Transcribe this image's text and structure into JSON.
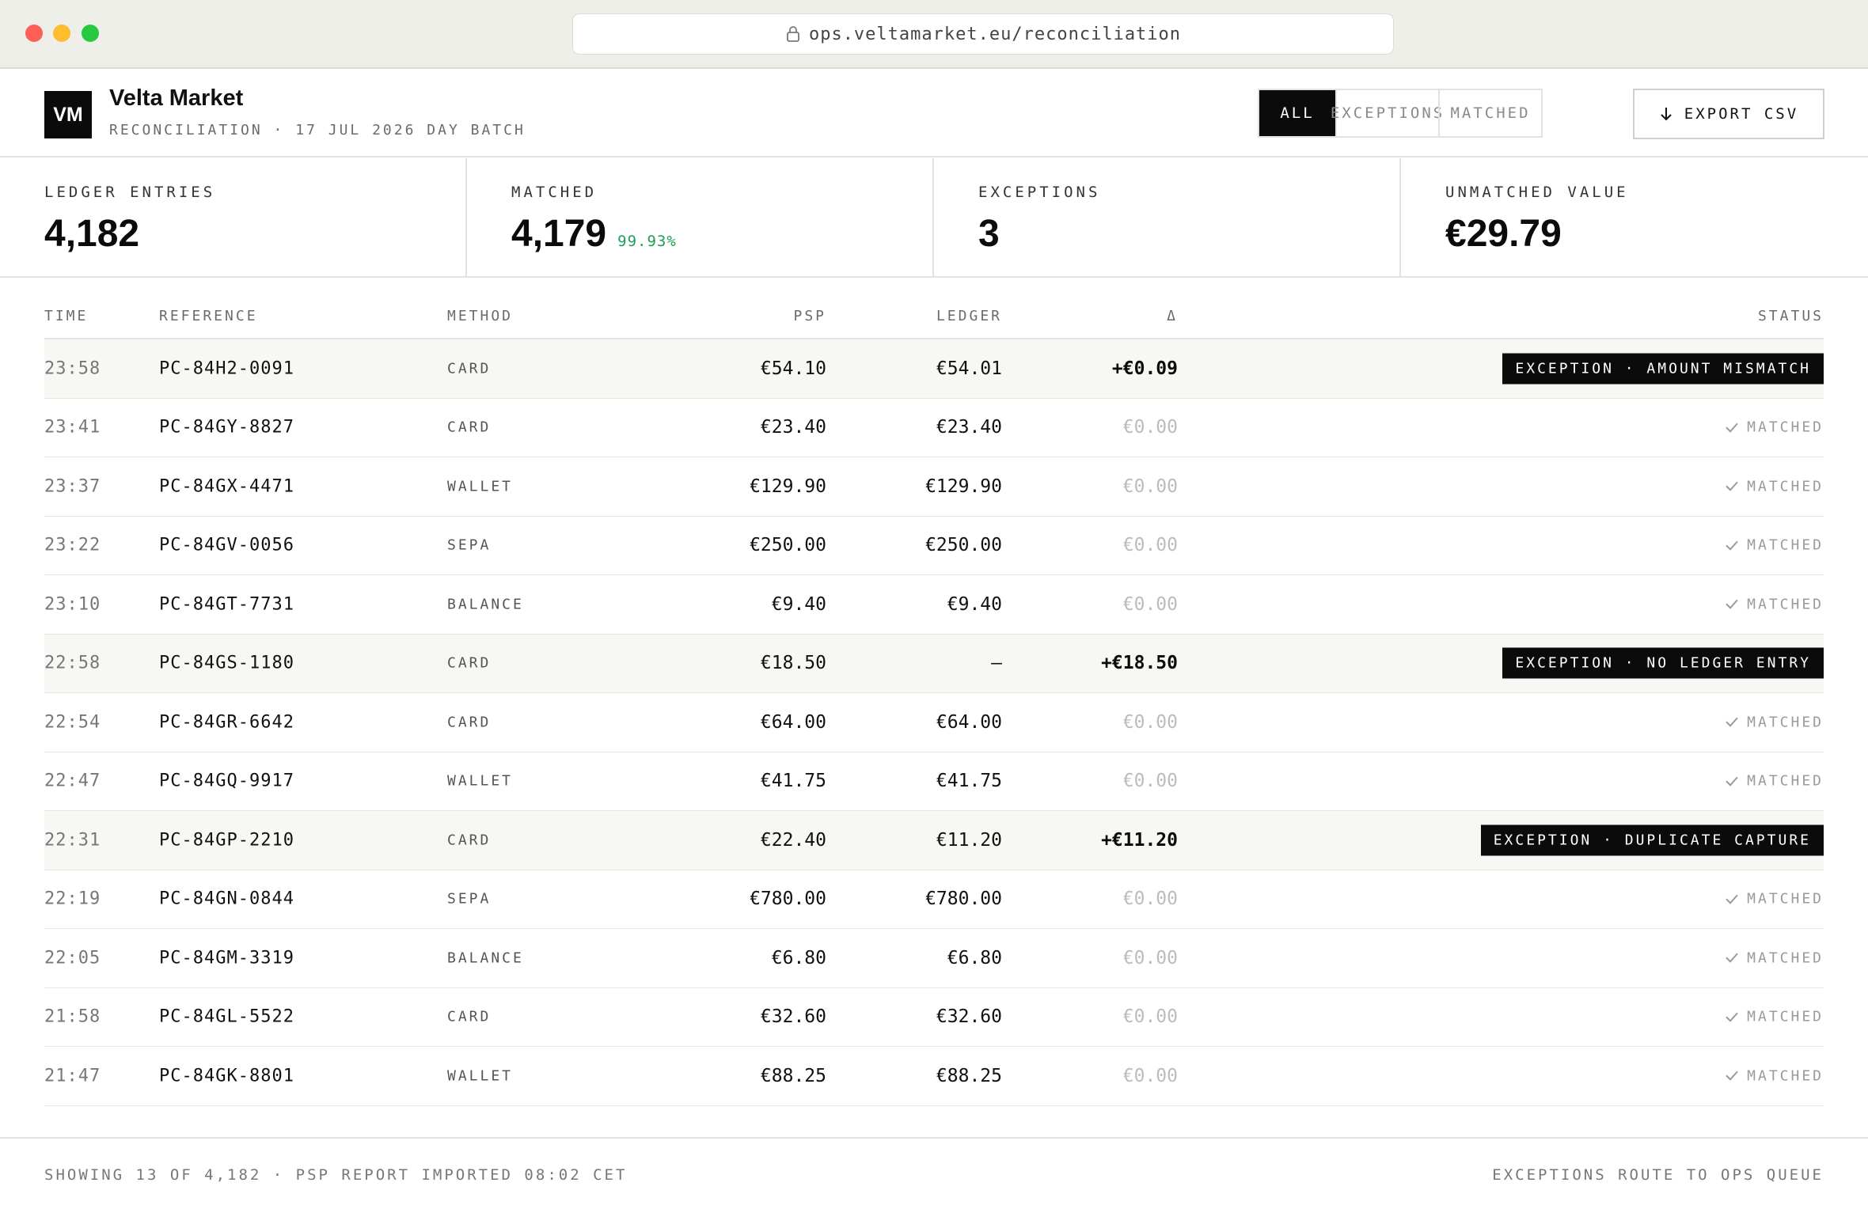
{
  "browser": {
    "url": "ops.veltamarket.eu/reconciliation"
  },
  "header": {
    "logo": "VM",
    "brand": "Velta Market",
    "subtitle": "RECONCILIATION · 17 JUL 2026 DAY BATCH",
    "filters": [
      "ALL",
      "EXCEPTIONS",
      "MATCHED"
    ],
    "active_filter": "ALL",
    "export_label": "EXPORT CSV"
  },
  "stats": [
    {
      "label": "LEDGER ENTRIES",
      "value": "4,182",
      "extra": ""
    },
    {
      "label": "MATCHED",
      "value": "4,179",
      "extra": "99.93%"
    },
    {
      "label": "EXCEPTIONS",
      "value": "3",
      "extra": ""
    },
    {
      "label": "UNMATCHED VALUE",
      "value": "€29.79",
      "extra": ""
    }
  ],
  "table": {
    "columns": [
      "TIME",
      "REFERENCE",
      "METHOD",
      "PSP",
      "LEDGER",
      "Δ",
      "STATUS"
    ],
    "rows": [
      {
        "time": "23:58",
        "ref": "PC-84H2-0091",
        "method": "CARD",
        "psp": "€54.10",
        "ledger": "€54.01",
        "delta": "+€0.09",
        "exception": true,
        "status": "EXCEPTION · AMOUNT MISMATCH"
      },
      {
        "time": "23:41",
        "ref": "PC-84GY-8827",
        "method": "CARD",
        "psp": "€23.40",
        "ledger": "€23.40",
        "delta": "€0.00",
        "exception": false,
        "status": "MATCHED"
      },
      {
        "time": "23:37",
        "ref": "PC-84GX-4471",
        "method": "WALLET",
        "psp": "€129.90",
        "ledger": "€129.90",
        "delta": "€0.00",
        "exception": false,
        "status": "MATCHED"
      },
      {
        "time": "23:22",
        "ref": "PC-84GV-0056",
        "method": "SEPA",
        "psp": "€250.00",
        "ledger": "€250.00",
        "delta": "€0.00",
        "exception": false,
        "status": "MATCHED"
      },
      {
        "time": "23:10",
        "ref": "PC-84GT-7731",
        "method": "BALANCE",
        "psp": "€9.40",
        "ledger": "€9.40",
        "delta": "€0.00",
        "exception": false,
        "status": "MATCHED"
      },
      {
        "time": "22:58",
        "ref": "PC-84GS-1180",
        "method": "CARD",
        "psp": "€18.50",
        "ledger": "—",
        "delta": "+€18.50",
        "exception": true,
        "status": "EXCEPTION · NO LEDGER ENTRY"
      },
      {
        "time": "22:54",
        "ref": "PC-84GR-6642",
        "method": "CARD",
        "psp": "€64.00",
        "ledger": "€64.00",
        "delta": "€0.00",
        "exception": false,
        "status": "MATCHED"
      },
      {
        "time": "22:47",
        "ref": "PC-84GQ-9917",
        "method": "WALLET",
        "psp": "€41.75",
        "ledger": "€41.75",
        "delta": "€0.00",
        "exception": false,
        "status": "MATCHED"
      },
      {
        "time": "22:31",
        "ref": "PC-84GP-2210",
        "method": "CARD",
        "psp": "€22.40",
        "ledger": "€11.20",
        "delta": "+€11.20",
        "exception": true,
        "status": "EXCEPTION · DUPLICATE CAPTURE"
      },
      {
        "time": "22:19",
        "ref": "PC-84GN-0844",
        "method": "SEPA",
        "psp": "€780.00",
        "ledger": "€780.00",
        "delta": "€0.00",
        "exception": false,
        "status": "MATCHED"
      },
      {
        "time": "22:05",
        "ref": "PC-84GM-3319",
        "method": "BALANCE",
        "psp": "€6.80",
        "ledger": "€6.80",
        "delta": "€0.00",
        "exception": false,
        "status": "MATCHED"
      },
      {
        "time": "21:58",
        "ref": "PC-84GL-5522",
        "method": "CARD",
        "psp": "€32.60",
        "ledger": "€32.60",
        "delta": "€0.00",
        "exception": false,
        "status": "MATCHED"
      },
      {
        "time": "21:47",
        "ref": "PC-84GK-8801",
        "method": "WALLET",
        "psp": "€88.25",
        "ledger": "€88.25",
        "delta": "€0.00",
        "exception": false,
        "status": "MATCHED"
      }
    ]
  },
  "footer": {
    "left": "SHOWING 13 OF 4,182 · PSP REPORT IMPORTED 08:02 CET",
    "right": "EXCEPTIONS ROUTE TO OPS QUEUE"
  },
  "colors": {
    "accent_dark": "#0b0b0b",
    "positive": "#1f9d55",
    "muted": "#9a9a9a"
  },
  "icons": {
    "url_lock": "lock-icon",
    "export": "arrow-down-icon",
    "matched": "check-icon"
  }
}
